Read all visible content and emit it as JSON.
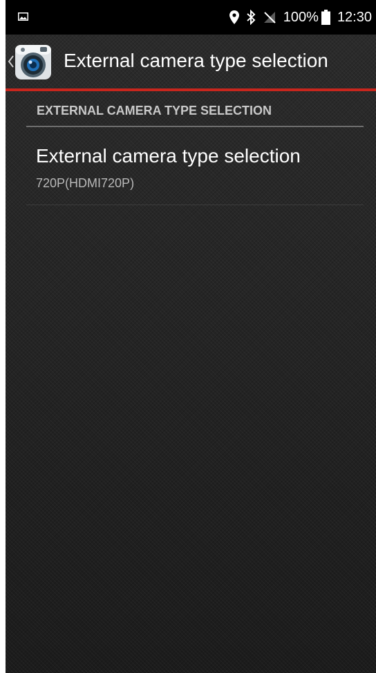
{
  "status_bar": {
    "battery": "100%",
    "time": "12:30",
    "icons": [
      "gallery-icon",
      "location-icon",
      "bluetooth-icon",
      "no-signal-icon",
      "battery-icon"
    ]
  },
  "action_bar": {
    "title": "External camera type selection",
    "back_icon": "chevron-left-icon",
    "app_icon": "camera-app-icon",
    "accent_color": "#c8261d"
  },
  "preferences": {
    "category_title": "EXTERNAL CAMERA TYPE SELECTION",
    "items": [
      {
        "title": "External camera type selection",
        "summary": "720P(HDMI720P)"
      }
    ]
  }
}
